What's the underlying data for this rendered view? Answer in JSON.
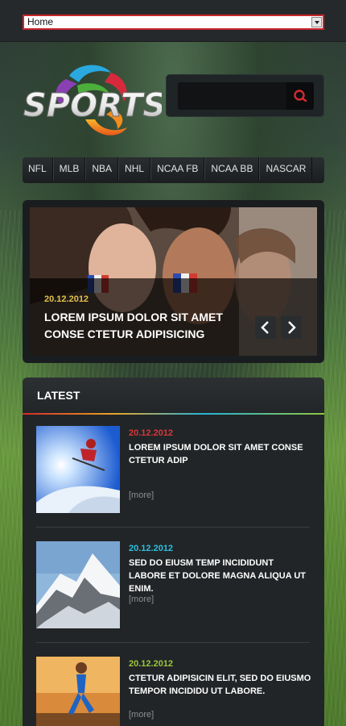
{
  "nav_select": {
    "value": "Home"
  },
  "logo": {
    "text": "SPORTS"
  },
  "search": {
    "placeholder": ""
  },
  "menu": {
    "items": [
      {
        "label": "NFL"
      },
      {
        "label": "MLB"
      },
      {
        "label": "NBA"
      },
      {
        "label": "NHL"
      },
      {
        "label": "NCAA FB"
      },
      {
        "label": "NCAA BB"
      },
      {
        "label": "NASCAR"
      }
    ]
  },
  "slider": {
    "date": "20.12.2012",
    "title": "LOREM IPSUM DOLOR SIT AMET CONSE CTETUR ADIPISICING"
  },
  "latest": {
    "heading": "LATEST",
    "more_label": "[more]",
    "posts": [
      {
        "date": "20.12.2012",
        "date_color": "#d8373a",
        "text": "LOREM IPSUM DOLOR SIT AMET CONSE CTETUR ADIP"
      },
      {
        "date": "20.12.2012",
        "date_color": "#2bc0e0",
        "text": "SED DO EIUSM TEMP INCIDIDUNT LABORE ET DOLORE MAGNA ALIQUA UT ENIM."
      },
      {
        "date": "20.12.2012",
        "date_color": "#9cc83a",
        "text": "CTETUR ADIPISICIN ELIT, SED DO EIUSMO TEMPOR INCIDIDU UT LABORE."
      }
    ]
  },
  "colors": {
    "accent_red": "#c8262c",
    "slider_date": "#e3c04a"
  }
}
